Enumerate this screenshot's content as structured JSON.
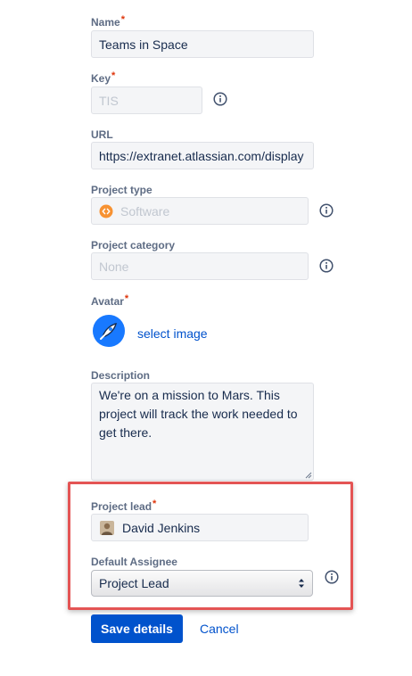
{
  "name": {
    "label": "Name",
    "required": "*",
    "value": "Teams in Space"
  },
  "key": {
    "label": "Key",
    "required": "*",
    "value": "TIS"
  },
  "url": {
    "label": "URL",
    "value": "https://extranet.atlassian.com/display"
  },
  "project_type": {
    "label": "Project type",
    "value": "Software",
    "icon": "software-icon"
  },
  "project_category": {
    "label": "Project category",
    "placeholder": "None"
  },
  "avatar": {
    "label": "Avatar",
    "required": "*",
    "select_label": "select image",
    "icon": "rocket-avatar-icon"
  },
  "description": {
    "label": "Description",
    "value": "We're on a mission to Mars. This project will track the work needed to get there."
  },
  "project_lead": {
    "label": "Project lead",
    "required": "*",
    "value": "David Jenkins",
    "icon": "user-avatar-icon"
  },
  "default_assignee": {
    "label": "Default Assignee",
    "value": "Project Lead"
  },
  "actions": {
    "save_label": "Save details",
    "cancel_label": "Cancel"
  },
  "colors": {
    "primary": "#0052cc",
    "required": "#de350b",
    "highlight": "#e45454",
    "software_badge": "#f79232"
  }
}
